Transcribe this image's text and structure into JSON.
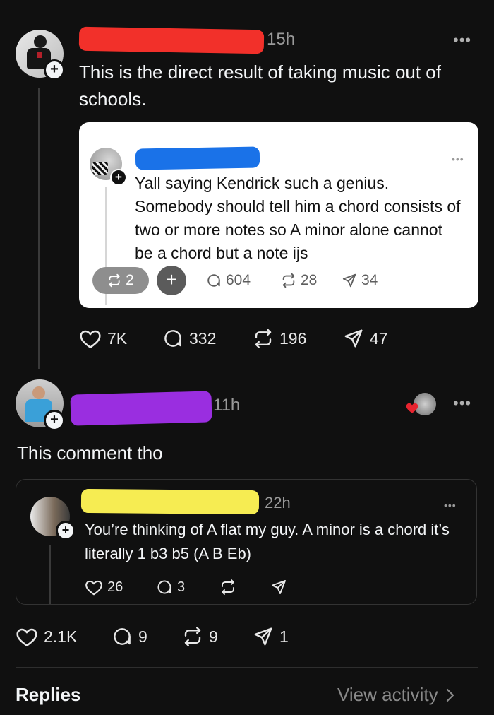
{
  "post1": {
    "time": "15h",
    "text": "This is the direct result of taking music out of schools.",
    "stats": {
      "likes": "7K",
      "replies": "332",
      "reposts": "196",
      "shares": "47"
    }
  },
  "quoted": {
    "text": "Yall saying Kendrick such a genius. Somebody should tell him a chord consists of two or more notes so A minor alone cannot be a chord but a note ijs",
    "reply_count": "2",
    "stats": {
      "replies": "604",
      "reposts": "28",
      "shares": "34"
    }
  },
  "post2": {
    "time": "11h",
    "text": "This comment tho",
    "stats": {
      "likes": "2.1K",
      "replies": "9",
      "reposts": "9",
      "shares": "1"
    }
  },
  "quoted2": {
    "time": "22h",
    "text": "You’re thinking of A flat my guy. A minor is a chord it’s literally 1 b3 b5 (A B Eb)",
    "stats": {
      "likes": "26",
      "replies": "3"
    }
  },
  "footer": {
    "replies_label": "Replies",
    "view_activity": "View activity"
  },
  "colors": {
    "redact_red": "#f2302a",
    "redact_blue": "#1a72e8",
    "redact_purple": "#9a2ee0",
    "redact_yellow": "#f6ec52",
    "liked_heart": "#e8242f"
  }
}
